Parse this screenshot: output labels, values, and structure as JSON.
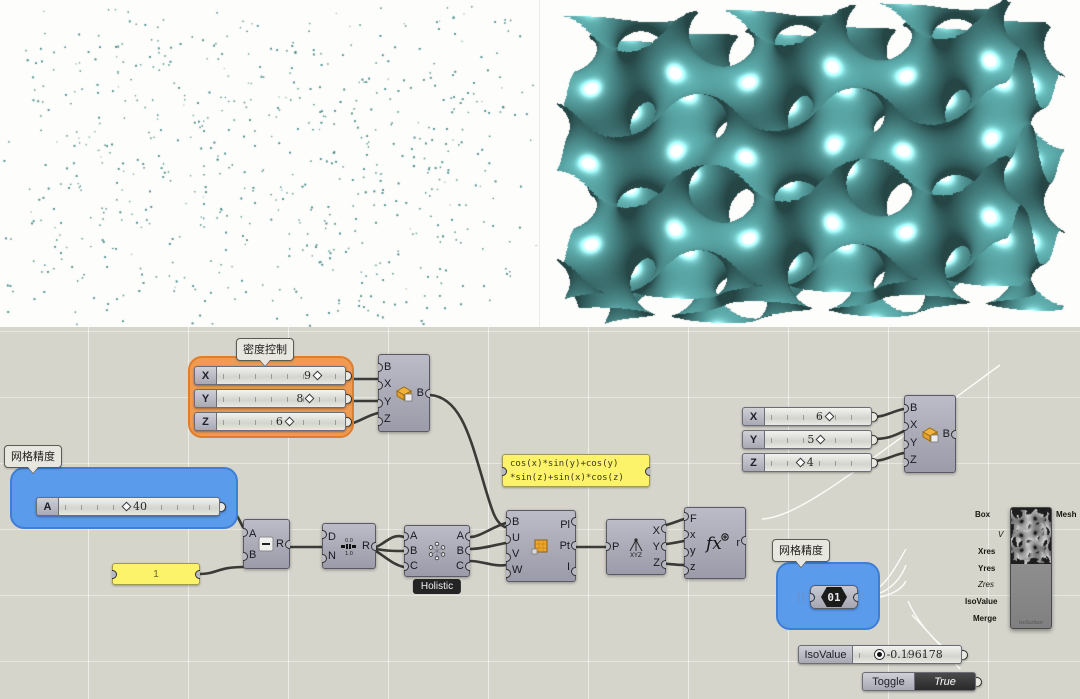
{
  "viewports": {
    "left": {
      "name": "point-cloud-viewport",
      "bg": "#fdfdfb",
      "point_color": "#4d8f8d"
    },
    "right": {
      "name": "gyroid-mesh-viewport",
      "bg": "#fdfdfb",
      "surface_color": "#5fb0b0",
      "highlight_color": "#eafeff"
    }
  },
  "groups": {
    "density": {
      "label": "密度控制",
      "color": "#ef9b52"
    },
    "mesh_precision_left": {
      "label": "网格精度",
      "color": "#5b9bec"
    },
    "mesh_precision_right": {
      "label": "网格精度",
      "color": "#5b9bec"
    }
  },
  "sliders": {
    "density": [
      {
        "name": "X",
        "value": "9",
        "handle": 0.72
      },
      {
        "name": "Y",
        "value": "8",
        "handle": 0.67
      },
      {
        "name": "Z",
        "value": "6",
        "handle": 0.56
      }
    ],
    "precision": {
      "name": "A",
      "value": "40",
      "handle": 0.4
    },
    "domain": [
      {
        "name": "X",
        "value": "6",
        "handle": 0.52
      },
      {
        "name": "Y",
        "value": "5",
        "handle": 0.46
      },
      {
        "name": "Z",
        "value": "4",
        "handle": 0.37
      }
    ],
    "isovalue": {
      "name": "IsoValue",
      "value": "-0.196178",
      "handle": 0.3
    }
  },
  "panels": {
    "count": "1",
    "expression_line1": "cos(x)*sin(y)+cos(y)",
    "expression_line2": "*sin(z)+sin(x)*cos(z)"
  },
  "toggle": {
    "label": "Toggle",
    "value": "True"
  },
  "capsule": {
    "value": "01"
  },
  "nodes": {
    "box_density": {
      "inputs": [
        "B",
        "X",
        "Y",
        "Z"
      ],
      "outputs": [
        "B"
      ],
      "icon": "box-icon"
    },
    "box_domain": {
      "inputs": [
        "B",
        "X",
        "Y",
        "Z"
      ],
      "outputs": [
        "B"
      ],
      "icon": "box-icon"
    },
    "subtract": {
      "inputs": [
        "A",
        "B"
      ],
      "outputs": [
        "R"
      ],
      "icon": "minus-icon"
    },
    "range": {
      "inputs": [
        "D",
        "N"
      ],
      "outputs": [
        "R"
      ],
      "icon": "range-icon",
      "icon_top": "0.0",
      "icon_bottom": "1.0"
    },
    "holistic": {
      "inputs": [
        "A",
        "B",
        "C"
      ],
      "outputs": [
        "A",
        "B",
        "C"
      ],
      "icon": "cross-reference-icon",
      "tag": "Holistic"
    },
    "populate": {
      "inputs": [
        "B",
        "U",
        "V",
        "W"
      ],
      "outputs": [
        "Pl",
        "Pt",
        "I"
      ],
      "icon": "box-grid-icon"
    },
    "deconstruct": {
      "inputs": [
        "P"
      ],
      "outputs": [
        "X",
        "Y",
        "Z"
      ],
      "icon": "xyz-icon",
      "icon_label": "XYZ"
    },
    "evaluate": {
      "inputs": [
        "F",
        "x",
        "y",
        "z"
      ],
      "outputs": [
        "r"
      ],
      "icon": "fx-icon"
    },
    "isosurface": {
      "inputs": [
        "Box",
        "V",
        "Xres",
        "Yres",
        "Zres",
        "IsoValue",
        "Merge"
      ],
      "outputs": [
        "Mesh"
      ],
      "caption": "IsoSurface",
      "italic_inputs": [
        "V",
        "Zres"
      ]
    }
  }
}
